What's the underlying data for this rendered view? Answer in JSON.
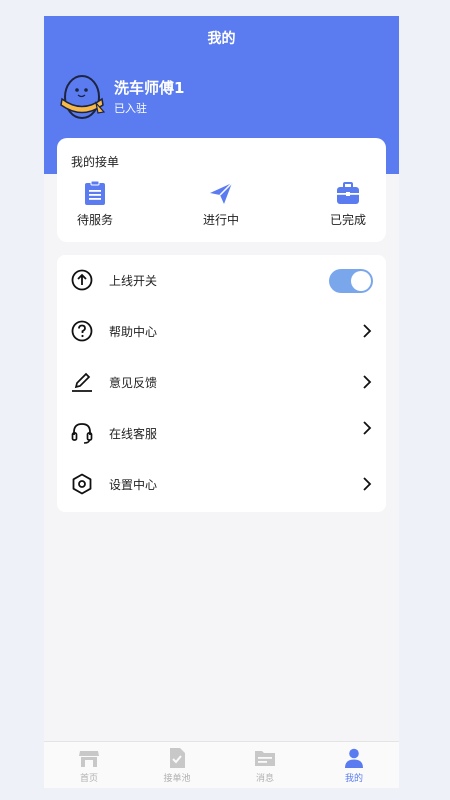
{
  "page": {
    "title": "我的"
  },
  "user": {
    "name": "洗车师傅1",
    "status": "已入驻"
  },
  "orders": {
    "title": "我的接单",
    "items": [
      {
        "label": "待服务",
        "icon": "clipboard-list-icon"
      },
      {
        "label": "进行中",
        "icon": "paper-plane-icon"
      },
      {
        "label": "已完成",
        "icon": "briefcase-icon"
      }
    ]
  },
  "menu": {
    "items": [
      {
        "label": "上线开关",
        "icon": "arrow-up-circle-icon",
        "control": "toggle",
        "toggle_on": true
      },
      {
        "label": "帮助中心",
        "icon": "help-circle-icon",
        "control": "chevron"
      },
      {
        "label": "意见反馈",
        "icon": "pencil-icon",
        "control": "chevron"
      },
      {
        "label": "在线客服",
        "icon": "headset-icon",
        "control": "chevron"
      },
      {
        "label": "设置中心",
        "icon": "settings-hexagon-icon",
        "control": "chevron"
      }
    ]
  },
  "tabbar": {
    "items": [
      {
        "label": "首页",
        "icon": "store-icon",
        "active": false
      },
      {
        "label": "接单池",
        "icon": "order-check-icon",
        "active": false
      },
      {
        "label": "消息",
        "icon": "folder-message-icon",
        "active": false
      },
      {
        "label": "我的",
        "icon": "person-icon",
        "active": true
      }
    ]
  },
  "colors": {
    "primary": "#5b7cf0",
    "toggle_on": "#7aa7ec",
    "tab_inactive": "#b0b0b0",
    "background": "#f5f5f7"
  }
}
